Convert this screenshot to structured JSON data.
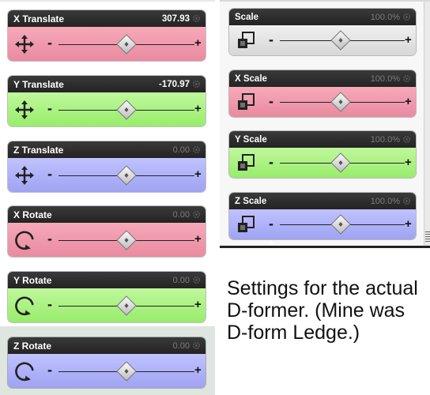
{
  "left_controls": [
    {
      "title": "X Translate",
      "value": "307.93",
      "icon": "move-arrows-icon",
      "color": "#e98aa0"
    },
    {
      "title": "Y Translate",
      "value": "-170.97",
      "icon": "move-arrows-icon",
      "color": "#98ec6c"
    },
    {
      "title": "Z Translate",
      "value": "0.00",
      "icon": "move-arrows-icon",
      "color": "#9fa3f2"
    },
    {
      "title": "X Rotate",
      "value": "0.00",
      "icon": "rotate-icon",
      "color": "#e98aa0"
    },
    {
      "title": "Y Rotate",
      "value": "0.00",
      "icon": "rotate-icon",
      "color": "#98ec6c"
    },
    {
      "title": "Z Rotate",
      "value": "0.00",
      "icon": "rotate-icon",
      "color": "#9fa3f2"
    }
  ],
  "right_controls": [
    {
      "title": "Scale",
      "value": "100.0%",
      "icon": "scale-squares-icon",
      "color": "#d7d7d7"
    },
    {
      "title": "X Scale",
      "value": "100.0%",
      "icon": "scale-squares-icon",
      "color": "#e98aa0"
    },
    {
      "title": "Y Scale",
      "value": "100.0%",
      "icon": "scale-squares-icon",
      "color": "#98ec6c"
    },
    {
      "title": "Z Scale",
      "value": "100.0%",
      "icon": "scale-squares-icon",
      "color": "#9fa3f2"
    }
  ],
  "slider_symbols": {
    "minus": "-",
    "plus": "+"
  },
  "caption": {
    "line1": "Settings for the actual",
    "line2": "D-former. (Mine was",
    "line3": "D-form Ledge.)"
  }
}
